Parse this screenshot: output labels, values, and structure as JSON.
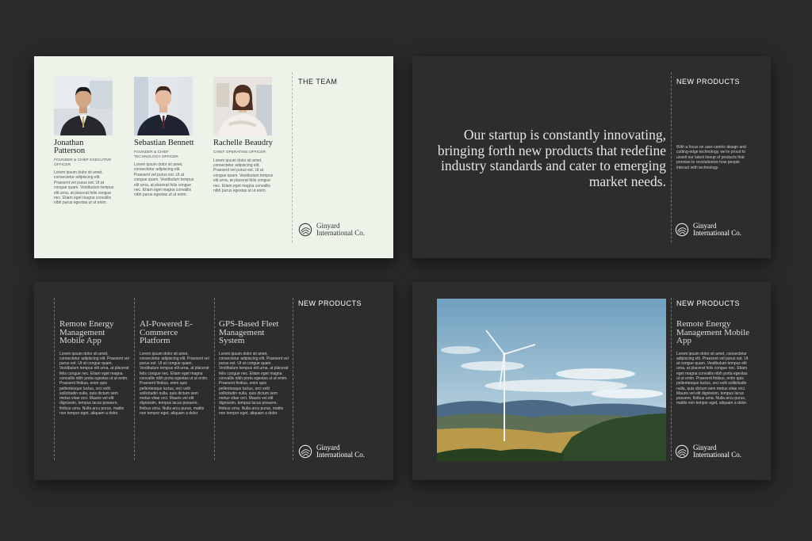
{
  "slides": {
    "team": {
      "title": "THE TEAM",
      "members": [
        {
          "name": "Jonathan Patterson",
          "role": "FOUNDER & CHIEF EXECUTIVE OFFICER",
          "bio": "Lorem ipsum dolor sit amet, consectetur adipiscing elit. Praesent vel purus est. Ut at congue quam. Vestibulum tempus elit urna, at placerat felis congue nec. Etiam eget magna convallis nibh purus egestas ut ut enim."
        },
        {
          "name": "Sebastian Bennett",
          "role": "FOUNDER & CHIEF TECHNOLOGY OFFICER",
          "bio": "Lorem ipsum dolor sit amet, consectetur adipiscing elit. Praesent vel purus est. Ut at congue quam. Vestibulum tempus elit urna, at placerat felis congue nec. Etiam eget magna convallis nibh purus egestas ut ut enim."
        },
        {
          "name": "Rachelle Beaudry",
          "role": "CHIEF OPERATING OFFICER",
          "bio": "Lorem ipsum dolor sit amet, consectetur adipiscing elit. Praesent vel purus est. Ut at congue quam. Vestibulum tempus elit urna, at placerat felis congue nec. Etiam eget magna convallis nibh purus egestas ut ut enim."
        }
      ]
    },
    "intro": {
      "title": "NEW PRODUCTS",
      "quote": "Our startup is constantly innovating, bringing forth new products that redefine industry standards and cater to emerging market needs.",
      "side_text": "With a focus on user-centric design and cutting-edge technology, we're proud to unveil our latest lineup of products that promise to revolutionize how people interact with technology."
    },
    "products": {
      "title": "NEW PRODUCTS",
      "items": [
        {
          "title": "Remote Energy Management Mobile App",
          "body": "Lorem ipsum dolor sit amet, consectetur adipiscing elit. Praesent vel purus est. Ut at congue quam. Vestibulum tempus elit urna, at placerat felis congue nec. Etiam eget magna convallis nibh porta egestas ut ut enim. Praesent finibus, enim quis pellentesque luctus, orci velit sollicitudin nulla, quis dictum sem metus vitae orci. Mauris vel elit dignissim, tempus lacus posuere, finibus urna. Nulla arcu purus, mattis non tempor eget, aliquam a dolor."
        },
        {
          "title": "AI-Powered E-Commerce Platform",
          "body": "Lorem ipsum dolor sit amet, consectetur adipiscing elit. Praesent vel purus est. Ut at congue quam. Vestibulum tempus elit urna, at placerat felis congue nec. Etiam eget magna convallis nibh porta egestas ut ut enim. Praesent finibus, enim quis pellentesque luctus, orci velit sollicitudin nulla, quis dictum sem metus vitae orci. Mauris vel elit dignissim, tempus lacus posuere, finibus urna. Nulla arcu purus, mattis non tempor eget, aliquam a dolor."
        },
        {
          "title": "GPS-Based Fleet Management System",
          "body": "Lorem ipsum dolor sit amet, consectetur adipiscing elit. Praesent vel purus est. Ut at congue quam. Vestibulum tempus elit urna, at placerat felis congue nec. Etiam eget magna convallis nibh porta egestas ut ut enim. Praesent finibus, enim quis pellentesque luctus, orci velit sollicitudin nulla, quis dictum sem metus vitae orci. Mauris vel elit dignissim, tempus lacus posuere, finibus urna. Nulla arcu purus, mattis non tempor eget, aliquam a dolor."
        }
      ]
    },
    "feature": {
      "title": "NEW PRODUCTS",
      "product_title": "Remote Energy Management Mobile App",
      "body": "Lorem ipsum dolor sit amet, consectetur adipiscing elit. Praesent vel purus est. Ut at congue quam. Vestibulum tempus elit urna, at placerat felis congue nec. Etiam eget magna convallis nibh porta egestas ut ut enim. Praesent finibus, enim quis pellentesque luctus, orci velit sollicitudin nulla, quis dictum sem metus vitae orci. Mauris vel elit dignissim, tempus lacus posuere, finibus urna. Nulla arcu purus, mattis non tempor eget, aliquam a dolor."
    }
  },
  "brand": {
    "logo_text": "Ginyard International Co.",
    "logo_icon": "spiral-logo-icon"
  },
  "colors": {
    "background": "#2a2a2a",
    "dark_slide": "#2d2d2d",
    "light_slide": "#eef3ea"
  }
}
